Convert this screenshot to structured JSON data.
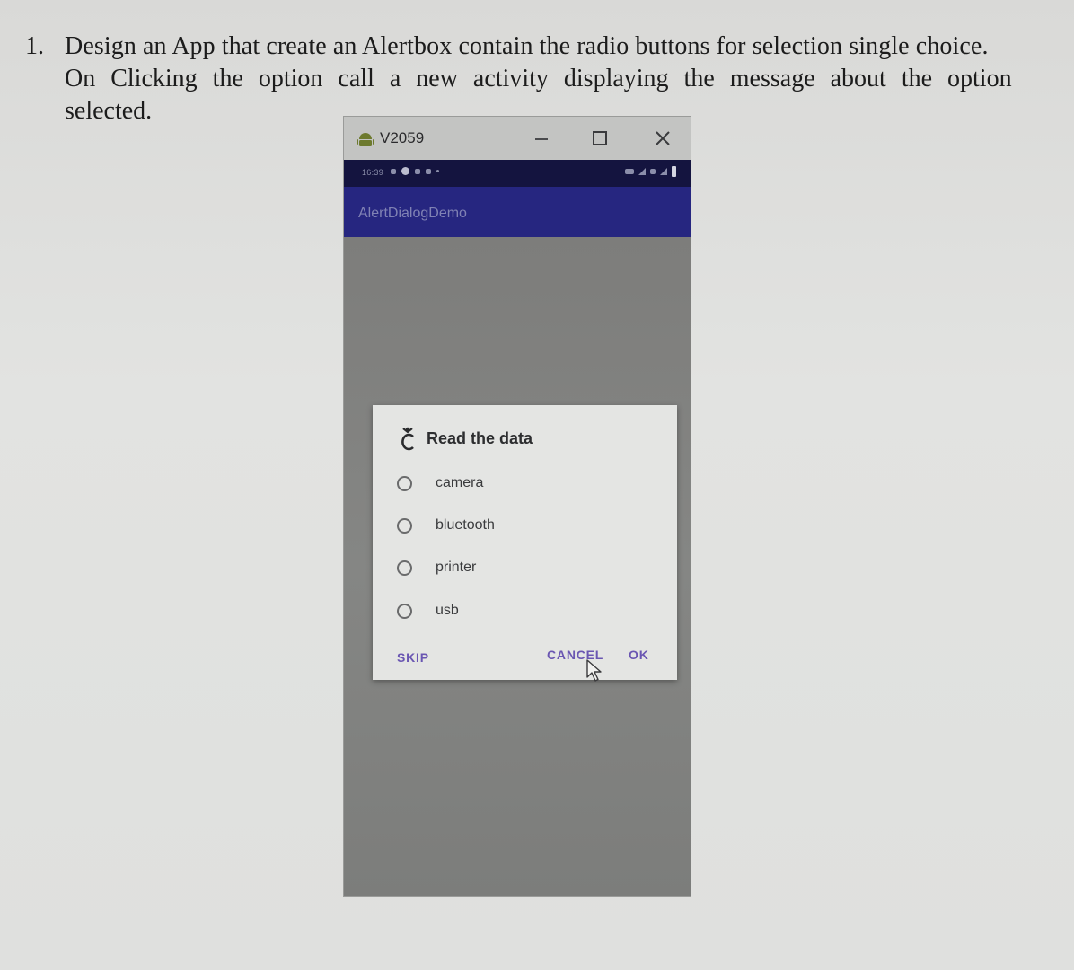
{
  "question": {
    "number": "1.",
    "line1": "Design an App that create an Alertbox contain the radio buttons for selection single choice.",
    "line2": "On Clicking the option call a new activity displaying the message about the option",
    "line3": "selected."
  },
  "emulator": {
    "window_title": "V2059",
    "icons": {
      "app": "android-icon",
      "minimize": "minimize-icon",
      "maximize": "maximize-icon",
      "close": "close-icon"
    },
    "status_bar": {
      "time": "16:39"
    },
    "app_bar": {
      "title": "AlertDialogDemo"
    },
    "dialog": {
      "icon": "app-icon",
      "title": "Read the data",
      "options": [
        {
          "label": "camera",
          "selected": false
        },
        {
          "label": "bluetooth",
          "selected": false
        },
        {
          "label": "printer",
          "selected": false
        },
        {
          "label": "usb",
          "selected": false
        }
      ],
      "buttons": {
        "neutral": "SKIP",
        "negative": "CANCEL",
        "positive": "OK"
      },
      "button_color": "#6a56b2"
    },
    "colors": {
      "status_bar": "#14143f",
      "app_bar": "#262680",
      "scrim": "#7d7d7b",
      "dialog_bg": "#e4e5e3"
    }
  }
}
